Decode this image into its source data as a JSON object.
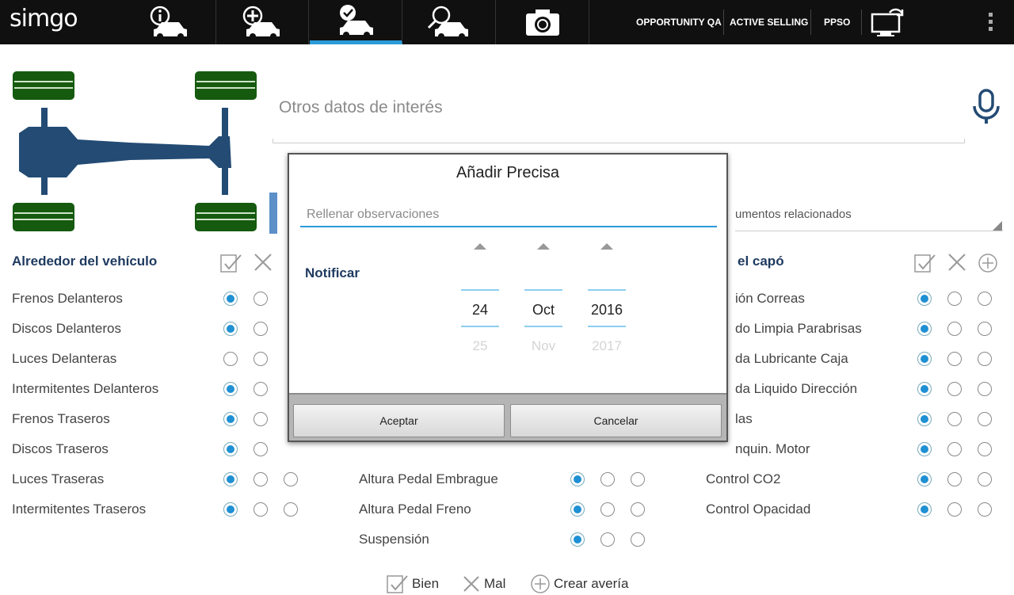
{
  "app": {
    "logo": "simgo",
    "nav_tabs": [
      {
        "name": "info-car"
      },
      {
        "name": "add-car"
      },
      {
        "name": "check-car"
      },
      {
        "name": "search-car"
      },
      {
        "name": "camera"
      }
    ],
    "links": [
      "OPPORTUNITY QA",
      "ACTIVE SELLING",
      "PPSO"
    ]
  },
  "notes": {
    "title": "Otros datos de interés"
  },
  "docs": {
    "label": "umentos relacionados"
  },
  "sections": {
    "left": {
      "title": "Alrededor del vehículo",
      "rows": [
        {
          "label": "Frenos Delanteros",
          "selected": 0
        },
        {
          "label": "Discos Delanteros",
          "selected": 0
        },
        {
          "label": "Luces Delanteras",
          "selected": -1
        },
        {
          "label": "Intermitentes Delanteros",
          "selected": 0
        },
        {
          "label": "Frenos Traseros",
          "selected": 0
        },
        {
          "label": "Discos Traseros",
          "selected": 0
        },
        {
          "label": "Luces Traseras",
          "selected": 0
        },
        {
          "label": "Intermitentes Traseros",
          "selected": 0
        }
      ]
    },
    "middle": {
      "rows": [
        {
          "label": "Altura Pedal Embrague",
          "selected": 0
        },
        {
          "label": "Altura Pedal Freno",
          "selected": 0
        },
        {
          "label": "Suspensión",
          "selected": 0
        }
      ]
    },
    "right": {
      "title": "el capó",
      "rows": [
        {
          "label": "ión Correas",
          "selected": 0
        },
        {
          "label": "do Limpia Parabrisas",
          "selected": 0
        },
        {
          "label": "da Lubricante Caja",
          "selected": 0
        },
        {
          "label": "da Liquido Dirección",
          "selected": 0
        },
        {
          "label": "las",
          "selected": 0
        },
        {
          "label": "nquin. Motor",
          "selected": 0
        },
        {
          "label": "Control CO2",
          "selected": 0
        },
        {
          "label": "Control Opacidad",
          "selected": 0
        }
      ]
    }
  },
  "legend": {
    "good": "Bien",
    "bad": "Mal",
    "create": "Crear avería"
  },
  "dialog": {
    "title": "Añadir Precisa",
    "placeholder": "Rellenar observaciones",
    "notify_label": "Notificar",
    "day": {
      "value": "24",
      "next": "25"
    },
    "month": {
      "value": "Oct",
      "next": "Nov"
    },
    "year": {
      "value": "2016",
      "next": "2017"
    },
    "accept": "Aceptar",
    "cancel": "Cancelar"
  },
  "colors": {
    "accent": "#2b9bd8",
    "title_blue": "#1e3a5f",
    "tyre_green": "#155a0f",
    "chassis_blue": "#234b74"
  }
}
